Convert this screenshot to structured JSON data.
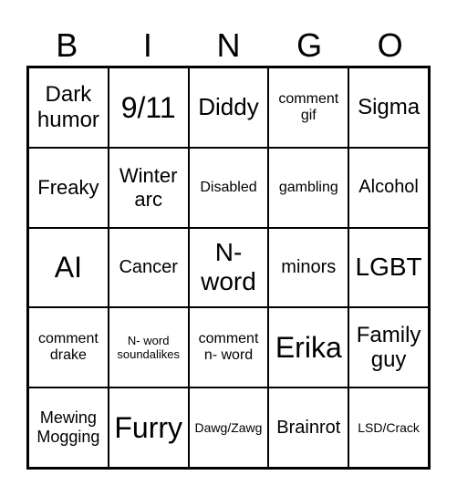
{
  "header": {
    "letters": [
      "B",
      "I",
      "N",
      "G",
      "O"
    ]
  },
  "cells": [
    "Dark\nhumor",
    "9/11",
    "Diddy",
    "comment\ngif",
    "Sigma",
    "Freaky",
    "Winter\narc",
    "Disabled",
    "gambling",
    "Alcohol",
    "AI",
    "Cancer",
    "N-\nword",
    "minors",
    "LGBT",
    "comment\ndrake",
    "N- word\nsoundalikes",
    "comment\nn- word",
    "Erika",
    "Family\nguy",
    "Mewing\nMogging",
    "Furry",
    "Dawg/Zawg",
    "Brainrot",
    "LSD/Crack"
  ]
}
